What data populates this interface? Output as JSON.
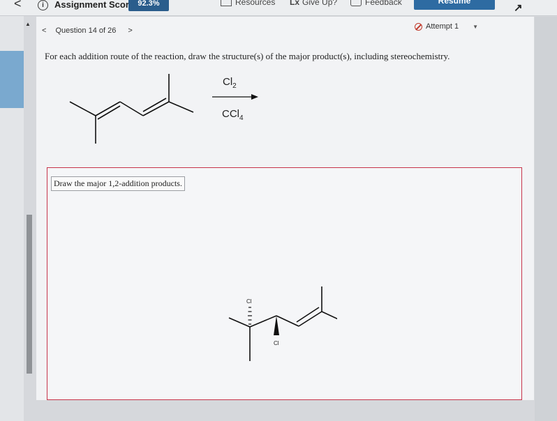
{
  "topbar": {
    "back": "<",
    "info_icon": "info-icon",
    "score_label": "Assignment Score:",
    "score_value": "92.3%",
    "resources": "Resources",
    "give_up": "Give Up?",
    "feedback": "Feedback",
    "resume": "Resume",
    "corner_icon": "expand-arrow-icon"
  },
  "question": {
    "nav_prev": "<",
    "label": "Question 14 of 26",
    "nav_next": ">",
    "attempt": "Attempt 1",
    "prompt": "For each addition route of the reaction, draw the structure(s) of the major product(s), including stereochemistry.",
    "reagent_top_main": "Cl",
    "reagent_top_sub": "2",
    "reagent_bottom_main": "CCl",
    "reagent_bottom_sub": "4"
  },
  "answer": {
    "label": "Draw the major 1,2-addition products.",
    "cl_top": "Cl",
    "cl_bottom": "Cl"
  },
  "colors": {
    "accent": "#2e6ba2",
    "attempt_red": "#c0392b",
    "box_border": "#c7334a"
  }
}
